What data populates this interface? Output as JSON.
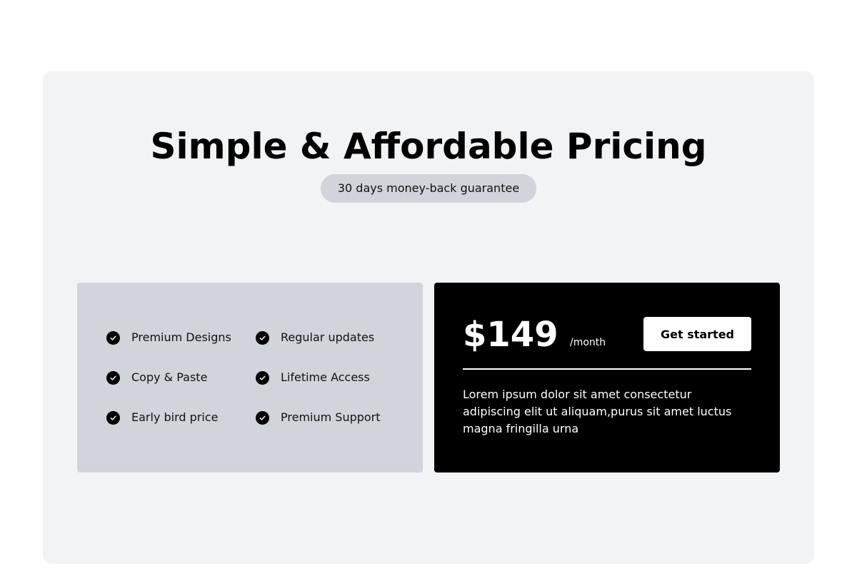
{
  "pricing": {
    "title": "Simple & Affordable Pricing",
    "badge": "30 days money-back guarantee",
    "features": [
      "Premium Designs",
      "Regular updates",
      "Copy & Paste",
      "Lifetime Access",
      "Early bird price",
      "Premium Support"
    ],
    "plan": {
      "price": "$149",
      "period": "/month",
      "cta_label": "Get started",
      "description": "Lorem ipsum dolor sit amet consectetur adipiscing elit ut aliquam,purus sit amet luctus magna fringilla urna"
    },
    "colors": {
      "background": "#ffffff",
      "section": "#f2f3f5",
      "features_card": "#d1d4db",
      "plan_card": "#000000",
      "accent": "#000000"
    }
  }
}
